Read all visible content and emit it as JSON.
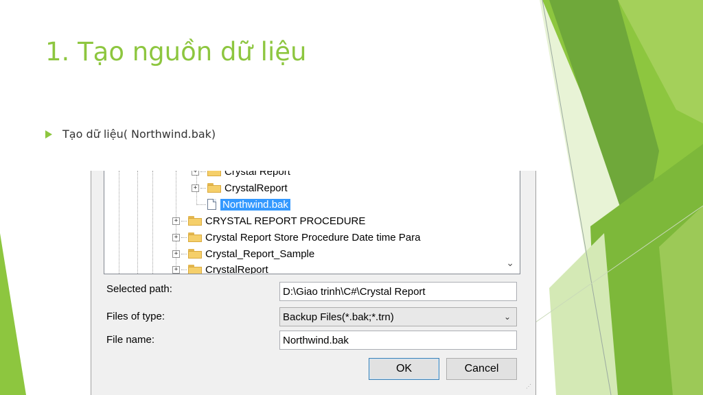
{
  "slide": {
    "title": "1. Tạo nguồn dữ liệu",
    "bullet": "Tạo dữ liệu( Northwind.bak)",
    "accent_color": "#8dc63f"
  },
  "tree": {
    "items": [
      {
        "label": "Crystal Report",
        "type": "folder",
        "level": 2,
        "expander": "+"
      },
      {
        "label": "CrystalReport",
        "type": "folder",
        "level": 2,
        "expander": "+"
      },
      {
        "label": "Northwind.bak",
        "type": "file",
        "level": 2,
        "selected": true
      },
      {
        "label": "CRYSTAL REPORT PROCEDURE",
        "type": "folder",
        "level": 1,
        "expander": "+"
      },
      {
        "label": "Crystal Report Store Procedure Date time Para",
        "type": "folder",
        "level": 1,
        "expander": "+"
      },
      {
        "label": "Crystal_Report_Sample",
        "type": "folder",
        "level": 1,
        "expander": "+"
      },
      {
        "label": "CrystalReport",
        "type": "folder",
        "level": 1,
        "expander": "+"
      }
    ],
    "selection_color": "#3399ff"
  },
  "form": {
    "selected_path_label": "Selected path:",
    "selected_path_value": "D:\\Giao trinh\\C#\\Crystal Report",
    "files_of_type_label": "Files of type:",
    "files_of_type_value": "Backup Files(*.bak;*.trn)",
    "file_name_label": "File name:",
    "file_name_value": "Northwind.bak"
  },
  "buttons": {
    "ok": "OK",
    "cancel": "Cancel"
  },
  "icons": {
    "tree_expand": "plus-box-icon",
    "folder": "folder-icon",
    "file": "file-icon",
    "dropdown": "chevron-down-icon",
    "scroll": "chevron-down-icon",
    "resize": "resize-grip-icon"
  }
}
